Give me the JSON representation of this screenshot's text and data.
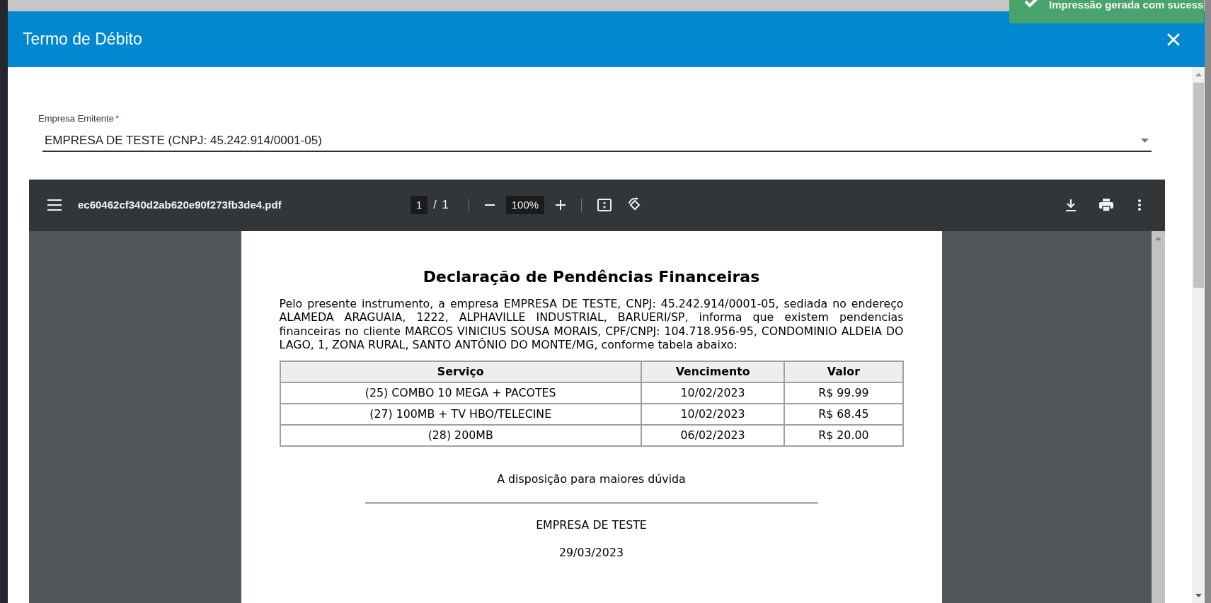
{
  "toast": {
    "text": "Impressão gerada com sucess"
  },
  "modal": {
    "title": "Termo de Débito",
    "field": {
      "label": "Empresa Emitente",
      "required_mark": "*",
      "value": "EMPRESA DE TESTE (CNPJ: 45.242.914/0001-05)"
    },
    "pdf_viewer": {
      "filename": "ec60462cf340d2ab620e90f273fb3de4.pdf",
      "page": "1",
      "separator": "/",
      "page_total": "1",
      "zoom": "100%",
      "document": {
        "title": "Declaração de Pendências Financeiras",
        "paragraph": "Pelo presente instrumento, a empresa EMPRESA DE TESTE, CNPJ: 45.242.914/0001-05, sediada no endereço ALAMEDA ARAGUAIA, 1222, ALPHAVILLE INDUSTRIAL, BARUERI/SP, informa que existem pendencias financeiras no cliente MARCOS VINICIUS SOUSA MORAIS, CPF/CNPJ: 104.718.956-95, CONDOMINIO ALDEIA DO LAGO, 1, ZONA RURAL, SANTO ANTÔNIO DO MONTE/MG, conforme tabela abaixo:",
        "table": {
          "columns": [
            "Serviço",
            "Vencimento",
            "Valor"
          ],
          "rows": [
            [
              "(25) COMBO 10 MEGA + PACOTES",
              "10/02/2023",
              "R$ 99.99"
            ],
            [
              "(27) 100MB + TV HBO/TELECINE",
              "10/02/2023",
              "R$ 68.45"
            ],
            [
              "(28) 200MB",
              "06/02/2023",
              "R$ 20.00"
            ]
          ]
        },
        "closing": "A disposição para maiores dúvida",
        "signer": "EMPRESA DE TESTE",
        "date": "29/03/2023"
      }
    }
  }
}
